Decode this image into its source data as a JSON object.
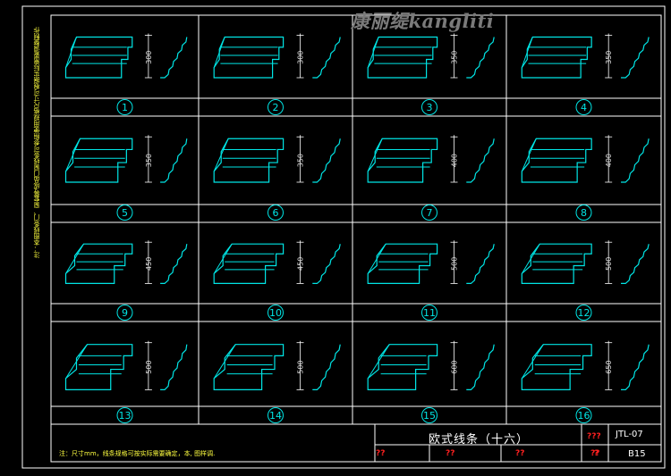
{
  "watermark": "康丽缇kangliti",
  "title": "欧式线条（十六）",
  "drawing_code": "JTL-07",
  "page": "B15",
  "unknown_marks": [
    "???",
    "??",
    "??",
    "??",
    "??",
    "?"
  ],
  "footnote": "注：尺寸mm，线条规格可按实际需要确定，本, 图样调.",
  "side_note": "注：本图线条门、窗套等成品门窗线条可参照使用规格尺寸可根据实际需要调整制作",
  "colors": {
    "line": "#00e5e5",
    "grid": "#ffffff",
    "accent_red": "#ff2020",
    "note_yellow": "#ffff40"
  },
  "panels": [
    {
      "num": "1",
      "dim": "300"
    },
    {
      "num": "2",
      "dim": "300"
    },
    {
      "num": "3",
      "dim": "350"
    },
    {
      "num": "4",
      "dim": "350"
    },
    {
      "num": "5",
      "dim": "350"
    },
    {
      "num": "6",
      "dim": "350"
    },
    {
      "num": "7",
      "dim": "400"
    },
    {
      "num": "8",
      "dim": "400"
    },
    {
      "num": "9",
      "dim": "450"
    },
    {
      "num": "10",
      "dim": "450"
    },
    {
      "num": "11",
      "dim": "500"
    },
    {
      "num": "12",
      "dim": "500"
    },
    {
      "num": "13",
      "dim": "500"
    },
    {
      "num": "14",
      "dim": "500"
    },
    {
      "num": "15",
      "dim": "600"
    },
    {
      "num": "16",
      "dim": "650"
    }
  ]
}
